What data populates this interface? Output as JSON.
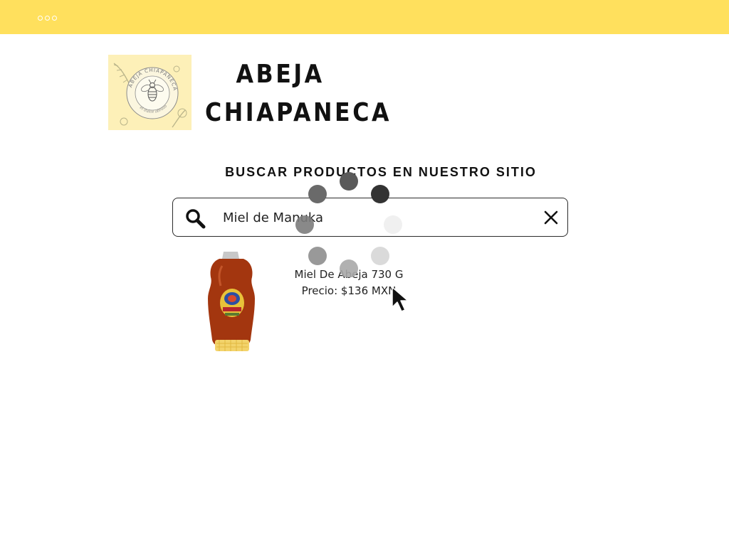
{
  "header": {
    "menu_icon": "more-dots-icon",
    "color": "#ffe05d"
  },
  "brand": {
    "name_line1": "ABEJA",
    "name_line2": "CHIAPANECA",
    "logo_ring_text": "ABEJA CHIAPANECA",
    "logo_tagline": "el dulce abrazo",
    "logo_bg": "#fdf0b8"
  },
  "search": {
    "heading": "BUSCAR PRODUCTOS EN NUESTRO SITIO",
    "value": "Miel de Manuka",
    "search_icon": "search-icon",
    "clear_icon": "close-icon"
  },
  "results": [
    {
      "name": "Miel De Abeja 730 G",
      "price": "Precio: $136 MXN",
      "image": "honey-bottle"
    }
  ],
  "loading": {
    "spinner_icon": "loading-spinner-icon"
  },
  "pointer": {
    "icon": "mouse-cursor-icon"
  }
}
